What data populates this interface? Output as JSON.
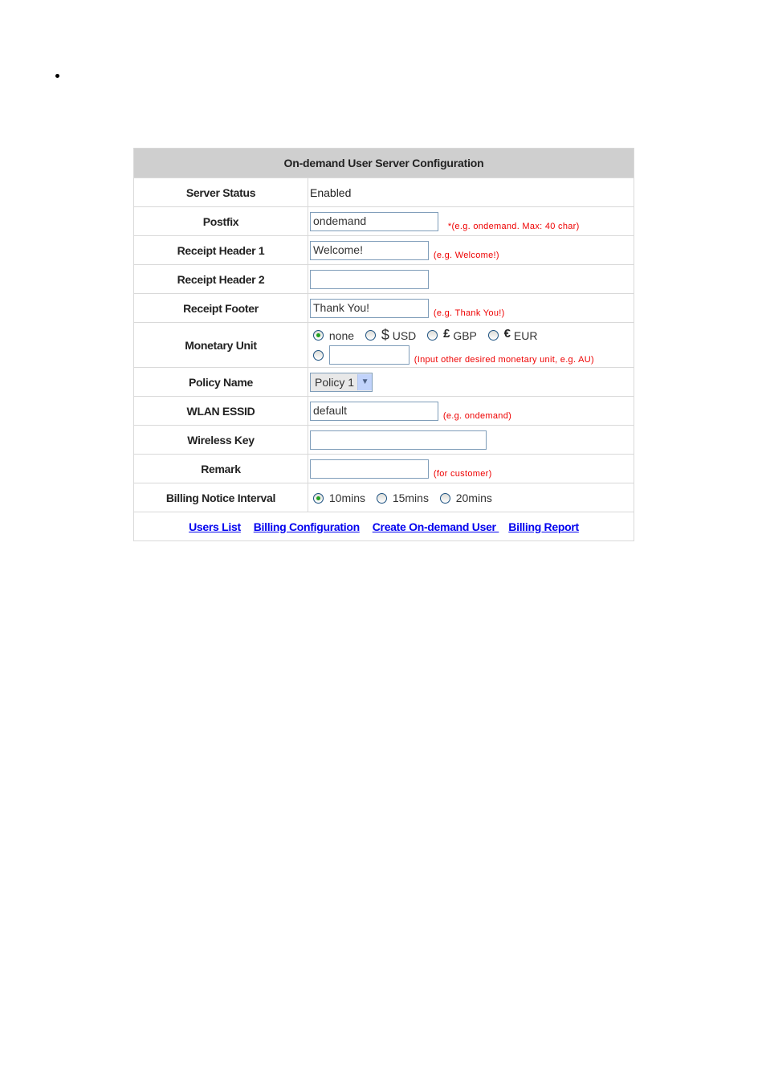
{
  "title": "On-demand User Server Configuration",
  "rows": {
    "server_status": {
      "label": "Server Status",
      "value": "Enabled"
    },
    "postfix": {
      "label": "Postfix",
      "value": "ondemand",
      "hint": "*(e.g. ondemand. Max: 40 char)"
    },
    "receipt_header_1": {
      "label": "Receipt Header 1",
      "value": "Welcome!",
      "hint": "(e.g. Welcome!)"
    },
    "receipt_header_2": {
      "label": "Receipt Header 2",
      "value": ""
    },
    "receipt_footer": {
      "label": "Receipt Footer",
      "value": "Thank You!",
      "hint": "(e.g. Thank You!)"
    },
    "monetary_unit": {
      "label": "Monetary Unit",
      "options": [
        {
          "symbol": "",
          "label": "none",
          "selected": true
        },
        {
          "symbol": "$",
          "label": "USD",
          "selected": false
        },
        {
          "symbol": "£",
          "label": "GBP",
          "selected": false
        },
        {
          "symbol": "€",
          "label": "EUR",
          "selected": false
        }
      ],
      "other_value": "",
      "other_hint": "(Input other desired monetary unit, e.g. AU)"
    },
    "policy_name": {
      "label": "Policy Name",
      "value": "Policy 1"
    },
    "wlan_essid": {
      "label": "WLAN ESSID",
      "value": "default",
      "hint": "(e.g. ondemand)"
    },
    "wireless_key": {
      "label": "Wireless Key",
      "value": ""
    },
    "remark": {
      "label": "Remark",
      "value": "",
      "hint": "(for customer)"
    },
    "billing_notice_interval": {
      "label": "Billing Notice Interval",
      "options": [
        {
          "label": "10mins",
          "selected": true
        },
        {
          "label": "15mins",
          "selected": false
        },
        {
          "label": "20mins",
          "selected": false
        }
      ]
    }
  },
  "links": [
    "Users List",
    "Billing Configuration",
    "Create On-demand User ",
    "Billing Report"
  ]
}
